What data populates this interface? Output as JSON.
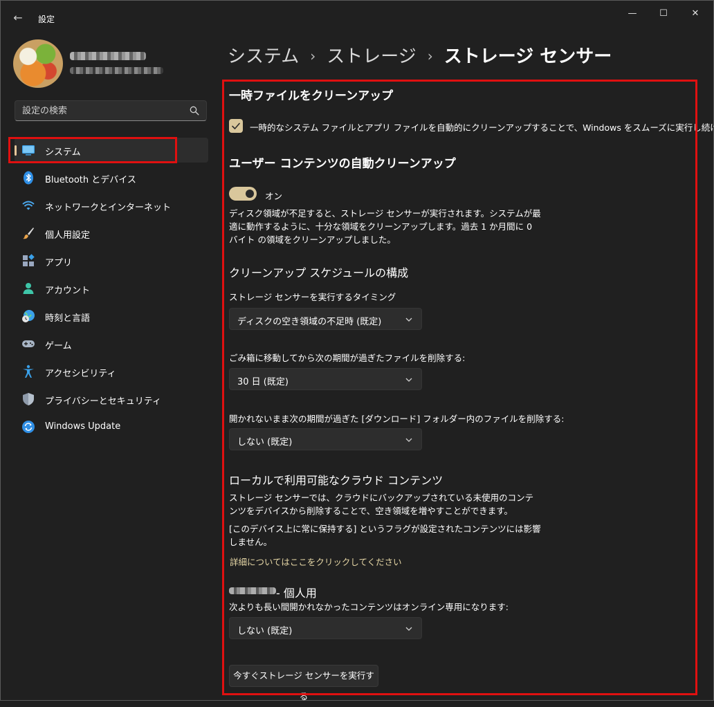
{
  "window": {
    "app_title": "設定",
    "back": "←",
    "minimize": "—",
    "maximize": "☐",
    "close": "✕"
  },
  "search": {
    "placeholder": "設定の検索"
  },
  "sidebar": {
    "items": [
      {
        "label": "システム",
        "icon": "system-icon",
        "active": true
      },
      {
        "label": "Bluetooth とデバイス",
        "icon": "bluetooth-icon"
      },
      {
        "label": "ネットワークとインターネット",
        "icon": "wifi-icon"
      },
      {
        "label": "個人用設定",
        "icon": "paintbrush-icon"
      },
      {
        "label": "アプリ",
        "icon": "apps-icon"
      },
      {
        "label": "アカウント",
        "icon": "account-icon"
      },
      {
        "label": "時刻と言語",
        "icon": "globe-clock-icon"
      },
      {
        "label": "ゲーム",
        "icon": "gamepad-icon"
      },
      {
        "label": "アクセシビリティ",
        "icon": "accessibility-icon"
      },
      {
        "label": "プライバシーとセキュリティ",
        "icon": "shield-icon"
      },
      {
        "label": "Windows Update",
        "icon": "refresh-icon"
      }
    ]
  },
  "breadcrumb": {
    "part1": "システム",
    "part2": "ストレージ",
    "current": "ストレージ センサー",
    "separator": "›"
  },
  "main": {
    "temp_cleanup": {
      "title": "一時ファイルをクリーンアップ",
      "checkbox_label": "一時的なシステム ファイルとアプリ ファイルを自動的にクリーンアップすることで、Windows をスムーズに実行し続けます",
      "checked": true
    },
    "auto_cleanup": {
      "title": "ユーザー コンテンツの自動クリーンアップ",
      "toggle_label": "オン",
      "toggle_on": true,
      "description": "ディスク領域が不足すると、ストレージ センサーが実行されます。システムが最適に動作するように、十分な領域をクリーンアップします。過去 1 か月間に 0 バイト の領域をクリーンアップしました。"
    },
    "schedule": {
      "title": "クリーンアップ スケジュールの構成",
      "run_label": "ストレージ センサーを実行するタイミング",
      "run_value": "ディスクの空き領域の不足時 (既定)",
      "recycle_label": "ごみ箱に移動してから次の期間が過ぎたファイルを削除する:",
      "recycle_value": "30 日 (既定)",
      "downloads_label": "開かれないまま次の期間が過ぎた [ダウンロード] フォルダー内のファイルを削除する:",
      "downloads_value": "しない (既定)"
    },
    "cloud": {
      "title": "ローカルで利用可能なクラウド コンテンツ",
      "desc1": "ストレージ センサーでは、クラウドにバックアップされている未使用のコンテンツをデバイスから削除することで、空き領域を増やすことができます。",
      "desc2": "[このデバイス上に常に保持する] というフラグが設定されたコンテンツには影響しません。",
      "link": "詳細についてはここをクリックしてください",
      "account_suffix": "- 個人用",
      "online_label": "次よりも長い間開かれなかったコンテンツはオンライン専用になります:",
      "online_value": "しない (既定)"
    },
    "run_now_button": "今すぐストレージ センサーを実行する"
  },
  "colors": {
    "background": "#202020",
    "card": "#2d2d2d",
    "accent": "#d9c79c",
    "link": "#e6d7a6",
    "highlight_box": "#e01010"
  }
}
